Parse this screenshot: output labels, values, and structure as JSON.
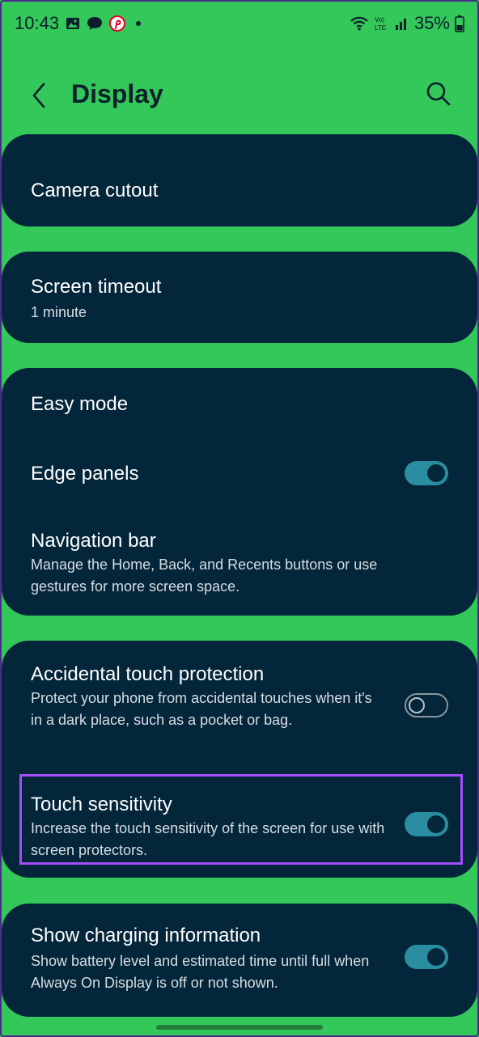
{
  "status_bar": {
    "time": "10:43",
    "battery": "35%",
    "icons": [
      "gallery-icon",
      "chat-icon",
      "pinterest-icon",
      "dot-icon",
      "wifi-icon",
      "volte-icon",
      "signal-icon",
      "battery-icon"
    ]
  },
  "app_bar": {
    "title": "Display",
    "back_icon": "chevron-left-icon",
    "search_icon": "search-icon"
  },
  "cards": {
    "camera": {
      "title": "Camera cutout"
    },
    "timeout": {
      "title": "Screen timeout",
      "subtitle": "1 minute"
    },
    "modes": {
      "easy_mode": "Easy mode",
      "edge_panels": {
        "title": "Edge panels",
        "enabled": true
      },
      "navigation_bar": {
        "title": "Navigation bar",
        "subtitle": "Manage the Home, Back, and Recents buttons or use gestures for more screen space."
      }
    },
    "touch": {
      "accidental": {
        "title": "Accidental touch protection",
        "subtitle": "Protect your phone from accidental touches when it's in a dark place, such as a pocket or bag.",
        "enabled": false
      },
      "sensitivity": {
        "title": "Touch sensitivity",
        "subtitle": "Increase the touch sensitivity of the screen for use with screen protectors.",
        "enabled": true
      }
    },
    "charging": {
      "title": "Show charging information",
      "subtitle": "Show battery level and estimated time until full when Always On Display is off or not shown.",
      "enabled": true
    }
  },
  "colors": {
    "background": "#34c759",
    "card": "#04263a",
    "toggle_on": "#2a8ea0",
    "highlight": "#a64dff"
  }
}
